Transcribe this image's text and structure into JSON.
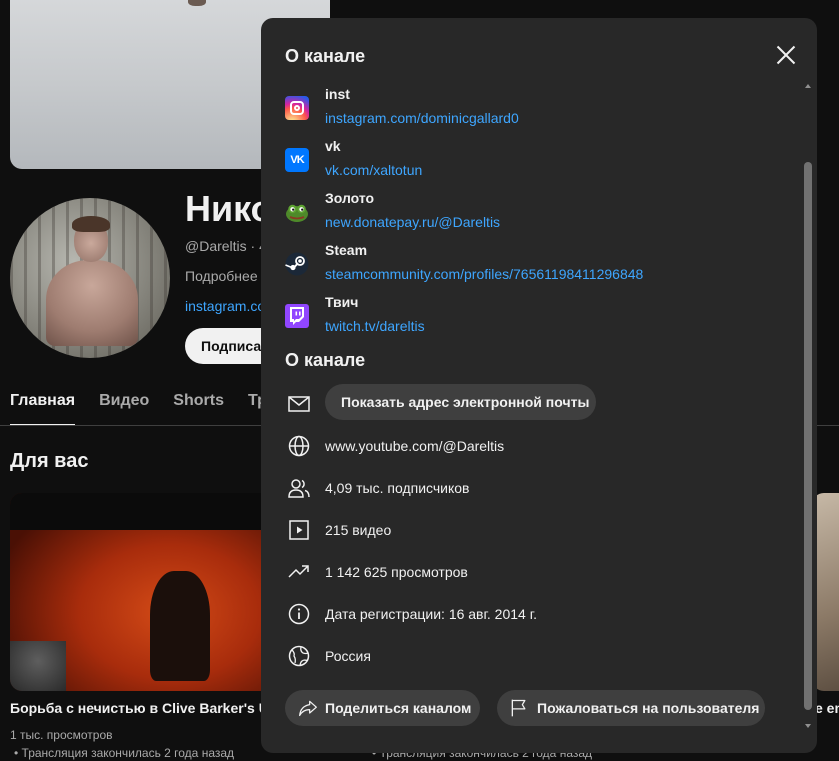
{
  "channel": {
    "name": "Нико",
    "handle": "@Dareltis · 4",
    "description_teaser": "Подробнее",
    "link_teaser": "instagram.co",
    "subscribe_label": "Подписат"
  },
  "tabs": [
    {
      "label": "Главная",
      "active": true
    },
    {
      "label": "Видео",
      "active": false
    },
    {
      "label": "Shorts",
      "active": false
    },
    {
      "label": "Тра",
      "active": false
    }
  ],
  "section_title": "Для вас",
  "videos": [
    {
      "title": "Борьба с нечистью в Clive Barker's Unc",
      "views": "1 тыс. просмотров",
      "status": "• Трансляция закончилась 2 года назад"
    },
    {
      "title": "е em",
      "views": "",
      "status": "• Трансляция закончилась 2 года назад"
    }
  ],
  "modal": {
    "links_title": "О канале",
    "links": [
      {
        "name": "inst",
        "url": "instagram.com/dominicgallard0",
        "icon": "instagram-icon"
      },
      {
        "name": "vk",
        "url": "vk.com/xaltotun",
        "icon": "vk-icon"
      },
      {
        "name": "Золото",
        "url": "new.donatepay.ru/@Dareltis",
        "icon": "pepe-frog-icon"
      },
      {
        "name": "Steam",
        "url": "steamcommunity.com/profiles/76561198411296848",
        "icon": "steam-icon"
      },
      {
        "name": "Твич",
        "url": "twitch.tv/dareltis",
        "icon": "twitch-icon"
      }
    ],
    "about_title": "О канале",
    "email_button": "Показать адрес электронной почты",
    "details": {
      "url": "www.youtube.com/@Dareltis",
      "subscribers": "4,09 тыс. подписчиков",
      "videos": "215 видео",
      "views": "1 142 625 просмотров",
      "joined": "Дата регистрации: 16 авг. 2014 г.",
      "country": "Россия"
    },
    "share_button": "Поделиться каналом",
    "report_button": "Пожаловаться на пользователя"
  },
  "colors": {
    "modal_bg": "#282828",
    "link": "#3ea6ff",
    "pill_bg": "#3f3f3f",
    "page_bg": "#0f0f0f"
  }
}
